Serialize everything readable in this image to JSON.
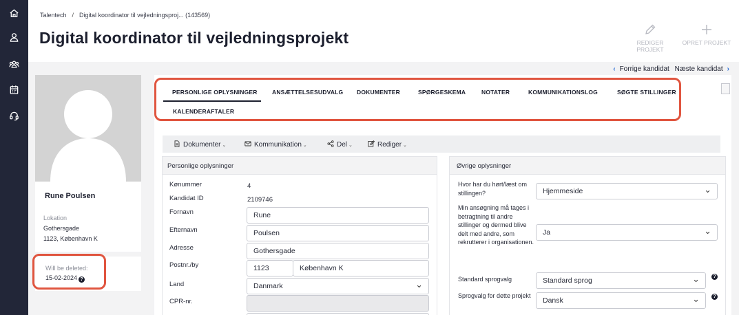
{
  "breadcrumb": {
    "root": "Talentech",
    "separator": "/",
    "current": "Digital koordinator til vejledningsproj... (143569)"
  },
  "page_title": "Digital koordinator til vejledningsprojekt",
  "header_actions": {
    "edit_label": "REDIGER PROJEKT",
    "create_label": "OPRET PROJEKT"
  },
  "candidate_nav": {
    "prev_label": "Forrige kandidat",
    "next_label": "Næste kandidat"
  },
  "profile": {
    "name": "Rune Poulsen",
    "location_label": "Lokation",
    "street": "Gothersgade",
    "city_line": "1123, København K"
  },
  "deletion": {
    "label": "Will be deleted:",
    "date": "15-02-2024"
  },
  "tabs": [
    {
      "label": "PERSONLIGE OPLYSNINGER",
      "active": true
    },
    {
      "label": "ANSÆTTELSESUDVALG"
    },
    {
      "label": "DOKUMENTER"
    },
    {
      "label": "SPØRGESKEMA"
    },
    {
      "label": "NOTATER"
    },
    {
      "label": "KOMMUNIKATIONSLOG"
    },
    {
      "label": "SØGTE STILLINGER"
    },
    {
      "label": "KALENDERAFTALER"
    }
  ],
  "toolbar": {
    "documents": "Dokumenter",
    "communication": "Kommunikation",
    "share": "Del",
    "edit": "Rediger"
  },
  "personal": {
    "title": "Personlige oplysninger",
    "gender_label": "Kønummer",
    "gender_value": "4",
    "candidate_id_label": "Kandidat ID",
    "candidate_id_value": "2109746",
    "first_name_label": "Fornavn",
    "first_name_value": "Rune",
    "last_name_label": "Efternavn",
    "last_name_value": "Poulsen",
    "address_label": "Adresse",
    "address_value": "Gothersgade",
    "zip_label": "Postnr./by",
    "zip_value": "1123",
    "city_value": "København K",
    "country_label": "Land",
    "country_value": "Danmark",
    "cpr_label": "CPR-nr.",
    "cpr_value": ""
  },
  "other": {
    "title": "Øvrige oplysninger",
    "heard_label": "Hvor har du hørt/læst om stillingen?",
    "heard_value": "Hjemmeside",
    "consent_label": "Min ansøgning må tages i betragtning til andre stillinger og dermed blive delt med andre, som rekrutterer i organisationen.",
    "consent_value": "Ja",
    "default_lang_label": "Standard sprogvalg",
    "default_lang_value": "Standard sprog",
    "project_lang_label": "Sprogvalg for dette projekt",
    "project_lang_value": "Dansk"
  }
}
